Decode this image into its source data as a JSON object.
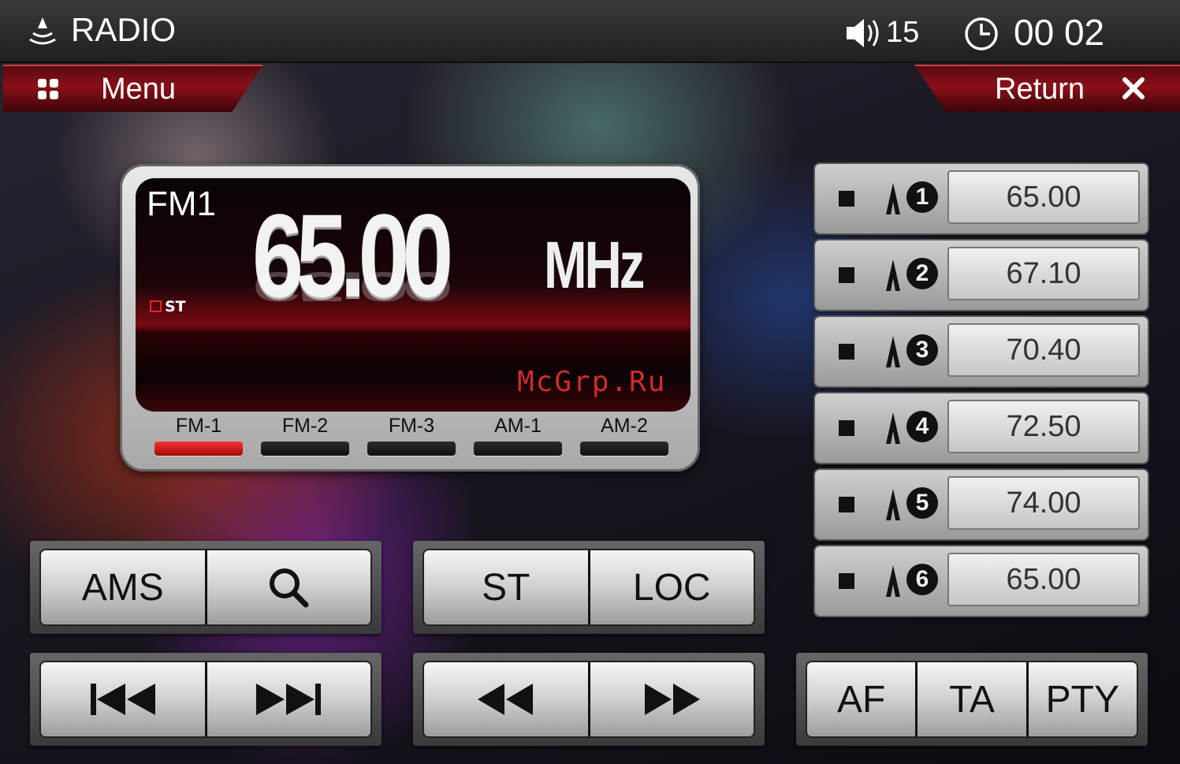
{
  "status_bar": {
    "title": "RADIO",
    "volume": "15",
    "time": "00 02"
  },
  "nav": {
    "menu_label": "Menu",
    "return_label": "Return"
  },
  "display": {
    "band": "FM1",
    "frequency": "65.00",
    "unit": "MHz",
    "stereo_indicator": "ST",
    "watermark": "McGrp.Ru",
    "bands": [
      {
        "label": "FM-1",
        "active": true
      },
      {
        "label": "FM-2",
        "active": false
      },
      {
        "label": "FM-3",
        "active": false
      },
      {
        "label": "AM-1",
        "active": false
      },
      {
        "label": "AM-2",
        "active": false
      }
    ]
  },
  "presets": [
    {
      "number": "1",
      "frequency": "65.00"
    },
    {
      "number": "2",
      "frequency": "67.10"
    },
    {
      "number": "3",
      "frequency": "70.40"
    },
    {
      "number": "4",
      "frequency": "72.50"
    },
    {
      "number": "5",
      "frequency": "74.00"
    },
    {
      "number": "6",
      "frequency": "65.00"
    }
  ],
  "controls": {
    "ams_label": "AMS",
    "st_label": "ST",
    "loc_label": "LOC",
    "af_label": "AF",
    "ta_label": "TA",
    "pty_label": "PTY"
  },
  "colors": {
    "accent_red": "#c8101a",
    "active_band": "#e01818"
  }
}
